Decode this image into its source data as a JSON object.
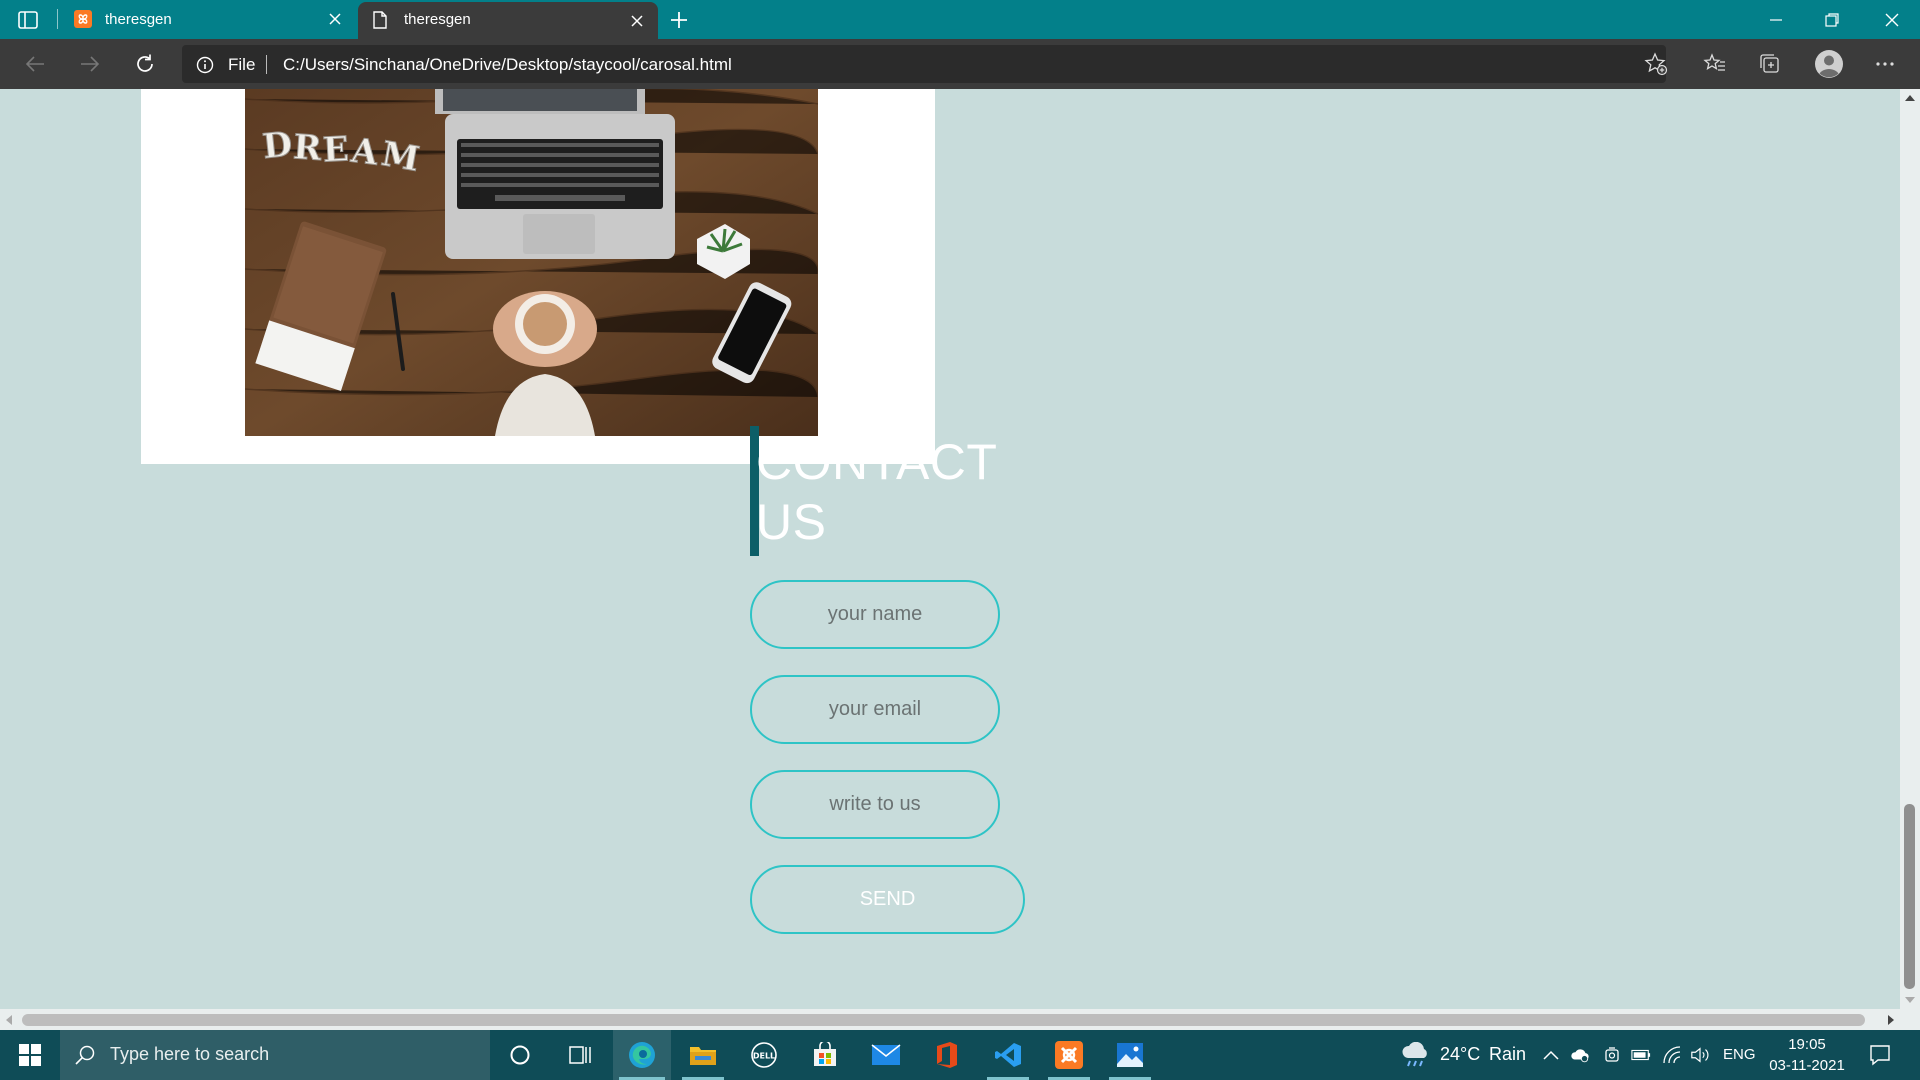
{
  "browser": {
    "tabs": [
      {
        "title": "theresgen",
        "favicon": "xampp-icon",
        "active": false
      },
      {
        "title": "theresgen",
        "favicon": "page-icon",
        "active": true
      }
    ],
    "address_bar": {
      "scheme_label": "File",
      "url": "C:/Users/Sinchana/OneDrive/Desktop/staycool/carosal.html"
    }
  },
  "page": {
    "contact": {
      "heading_line1": "CONTACT",
      "heading_line2": "US",
      "name_placeholder": "your name",
      "email_placeholder": "your email",
      "message_placeholder": "write to us",
      "send_label": "SEND"
    },
    "colors": {
      "background": "#c8dcdb",
      "accent_border": "#2ec4c6",
      "heading_bar": "#0c5e67"
    }
  },
  "taskbar": {
    "search_placeholder": "Type here to search",
    "weather": {
      "temperature": "24°C",
      "condition": "Rain"
    },
    "language": "ENG",
    "time": "19:05",
    "date": "03-11-2021"
  }
}
